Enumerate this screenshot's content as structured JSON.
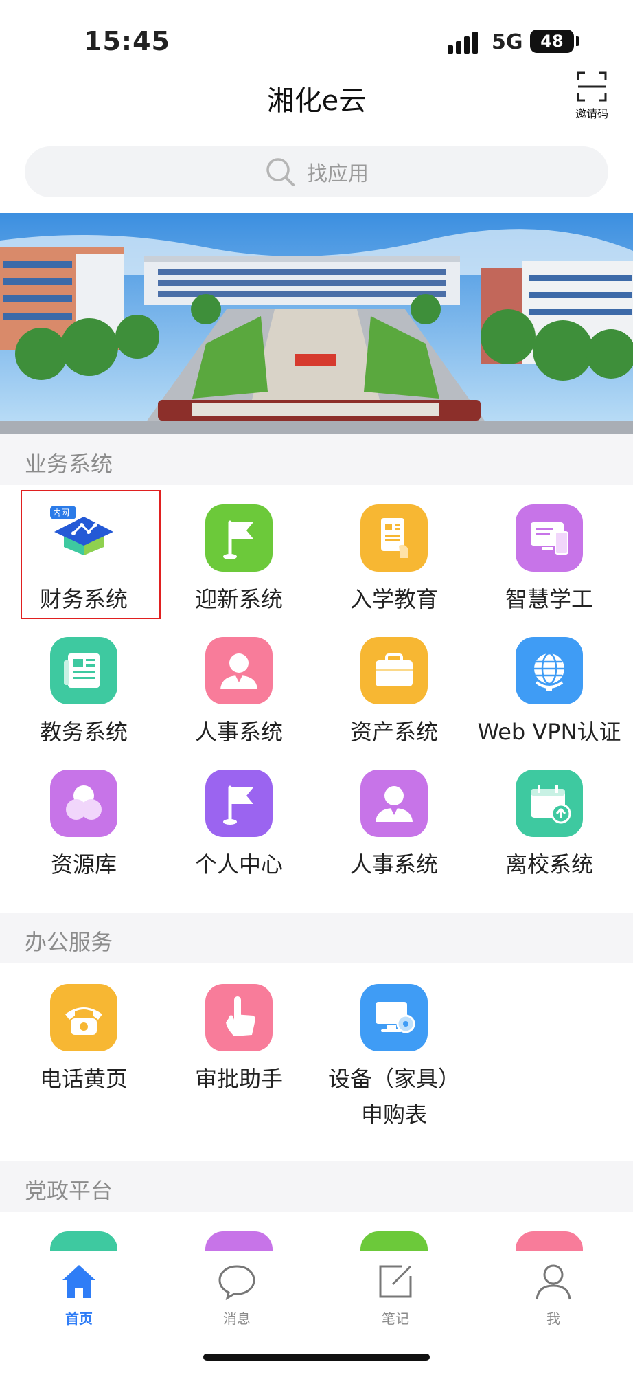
{
  "status_bar": {
    "time": "15:45",
    "network": "5G",
    "battery": "48"
  },
  "header": {
    "title": "湘化e云",
    "invite_label": "邀请码"
  },
  "search": {
    "placeholder": "找应用"
  },
  "sections": {
    "business": {
      "title": "业务系统",
      "items": [
        {
          "label": "财务系统",
          "icon": "graduation-cap-icon",
          "badge": "内网",
          "color": "#2b7be8"
        },
        {
          "label": "迎新系统",
          "icon": "flag-icon",
          "color": "#6cc93a"
        },
        {
          "label": "入学教育",
          "icon": "document-hand-icon",
          "color": "#f7b733"
        },
        {
          "label": "智慧学工",
          "icon": "monitor-phone-icon",
          "color": "#c774e8"
        },
        {
          "label": "教务系统",
          "icon": "newspaper-icon",
          "color": "#3ec9a0"
        },
        {
          "label": "人事系统",
          "icon": "person-icon",
          "color": "#f87c9a"
        },
        {
          "label": "资产系统",
          "icon": "briefcase-icon",
          "color": "#f7b733"
        },
        {
          "label": "Web VPN认证",
          "icon": "globe-icon",
          "color": "#3f9cf5"
        },
        {
          "label": "资源库",
          "icon": "circles-icon",
          "color": "#c774e8"
        },
        {
          "label": "个人中心",
          "icon": "flag-icon",
          "color": "#9b64f0"
        },
        {
          "label": "人事系统",
          "icon": "person-icon",
          "color": "#c774e8"
        },
        {
          "label": "离校系统",
          "icon": "calendar-upload-icon",
          "color": "#3ec9a0"
        }
      ]
    },
    "office": {
      "title": "办公服务",
      "items": [
        {
          "label": "电话黄页",
          "icon": "telephone-icon",
          "color": "#f7b733"
        },
        {
          "label": "审批助手",
          "icon": "pointing-hand-icon",
          "color": "#f87c9a"
        },
        {
          "label": "设备（家具）",
          "label2": "申购表",
          "icon": "computer-icon",
          "color": "#3f9cf5"
        }
      ]
    },
    "party": {
      "title": "党政平台",
      "colors": [
        "#3ec9a0",
        "#c774e8",
        "#6cc93a",
        "#f87c9a"
      ]
    }
  },
  "tabbar": {
    "items": [
      {
        "label": "首页",
        "icon": "home-icon",
        "active": true
      },
      {
        "label": "消息",
        "icon": "chat-bubble-icon"
      },
      {
        "label": "笔记",
        "icon": "note-edit-icon"
      },
      {
        "label": "我",
        "icon": "user-icon"
      }
    ],
    "active_color": "#2f7df6"
  }
}
